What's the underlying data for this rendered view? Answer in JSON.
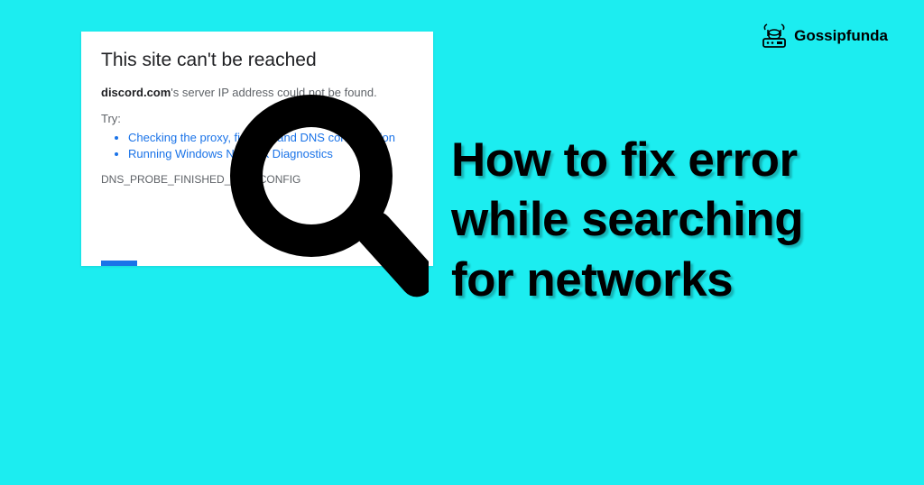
{
  "brand": {
    "name": "Gossipfunda"
  },
  "headline": {
    "line1": "How to fix error",
    "line2": "while searching",
    "line3": "for networks"
  },
  "error_page": {
    "title": "This site can't be reached",
    "domain": "discord.com",
    "desc_suffix": "'s server IP address could not be found.",
    "try_label": "Try:",
    "suggestions": [
      "Checking the proxy, firewall, and DNS configuration",
      "Running Windows Network Diagnostics"
    ],
    "error_code": "DNS_PROBE_FINISHED_BAD_CONFIG"
  }
}
